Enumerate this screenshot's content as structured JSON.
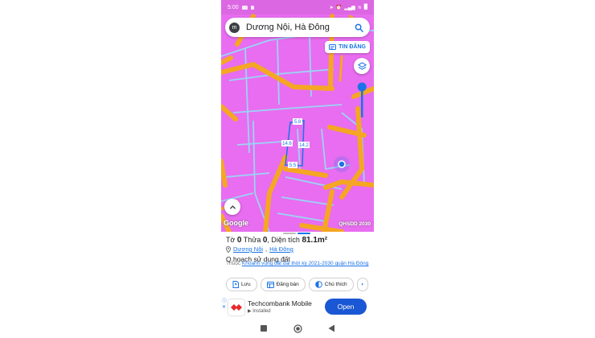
{
  "status_bar": {
    "time": "5:00",
    "battery": "█"
  },
  "search": {
    "query": "Dương Nội, Hà Đông",
    "avatar_letter": "m"
  },
  "map": {
    "post_listing_label": "TIN ĐĂNG",
    "google_logo": "Google",
    "credit": "QHSDD 2030",
    "parcel_dims": [
      "5.8",
      "14.6",
      "14.2",
      "5.5"
    ],
    "colors": {
      "land": "#e86df0",
      "road": "#f5a623",
      "boundary": "#9ad4f5",
      "accent": "#1a73e8"
    }
  },
  "sheet": {
    "title_prefix": "Tờ ",
    "sheet_no": "0",
    "parcel_prefix": " Thửa ",
    "parcel_no": "0",
    "area_prefix": ", Diện tích ",
    "area_value": "81.1m²",
    "location_ward": "Dương Nội",
    "location_sep": ", ",
    "location_district": "Hà Đông",
    "plan_heading": "Q.hoach sử dụng đất",
    "plan_prefix": "Thuộc ",
    "plan_link": "Khoanh vùng đất đai thời kỳ 2021-2030 quận Hà Đông",
    "actions": [
      {
        "label": "Lưu",
        "icon": "save-icon"
      },
      {
        "label": "Đăng bán",
        "icon": "listing-icon"
      },
      {
        "label": "Chú thích",
        "icon": "legend-icon"
      }
    ]
  },
  "ad": {
    "title": "Techcombank Mobile",
    "subtitle": "Installed",
    "open_label": "Open"
  }
}
